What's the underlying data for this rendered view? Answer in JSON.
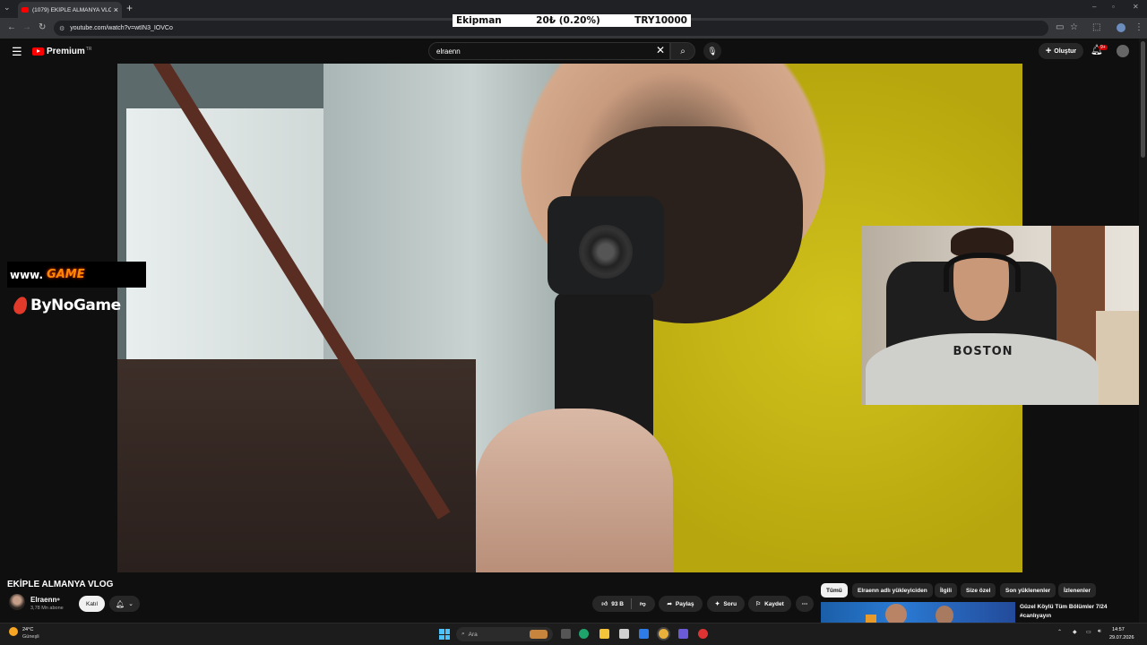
{
  "browser": {
    "tab_title": "(1079) EKİPLE ALMANYA VLOG",
    "url": "youtube.com/watch?v=wtIN3_IOVCo"
  },
  "ticker": {
    "label": "Ekipman",
    "change": "20₺ (0.20%)",
    "goal": "TRY10000"
  },
  "header": {
    "logo_text": "Premium",
    "logo_region": "TR",
    "search_value": "elraenn",
    "create_label": "Oluştur",
    "notif_count": "9+"
  },
  "overlay": {
    "banner_left": "www.",
    "banner_right": "GAME",
    "brand": "ByNoGame",
    "shirt_text": "BOSTON"
  },
  "video": {
    "title": "EKİPLE ALMANYA VLOG",
    "channel": "Elraenn",
    "subscribers": "3,78 Mn abone",
    "join_label": "Katıl",
    "like_count": "93 B",
    "share_label": "Paylaş",
    "ask_label": "Soru",
    "save_label": "Kaydet"
  },
  "chips": [
    "Tümü",
    "Elraenn adlı yükleyiciden",
    "İlgili",
    "Size özel",
    "Son yüklenenler",
    "İzlenenler"
  ],
  "recommendation": {
    "title": "Güzel Köylü Tüm Bölümler 7/24 #canlıyayın"
  },
  "taskbar": {
    "weather_temp": "24°C",
    "weather_desc": "Güneşli",
    "search_placeholder": "Ara",
    "time": "14:57",
    "date": "29.07.2026"
  }
}
